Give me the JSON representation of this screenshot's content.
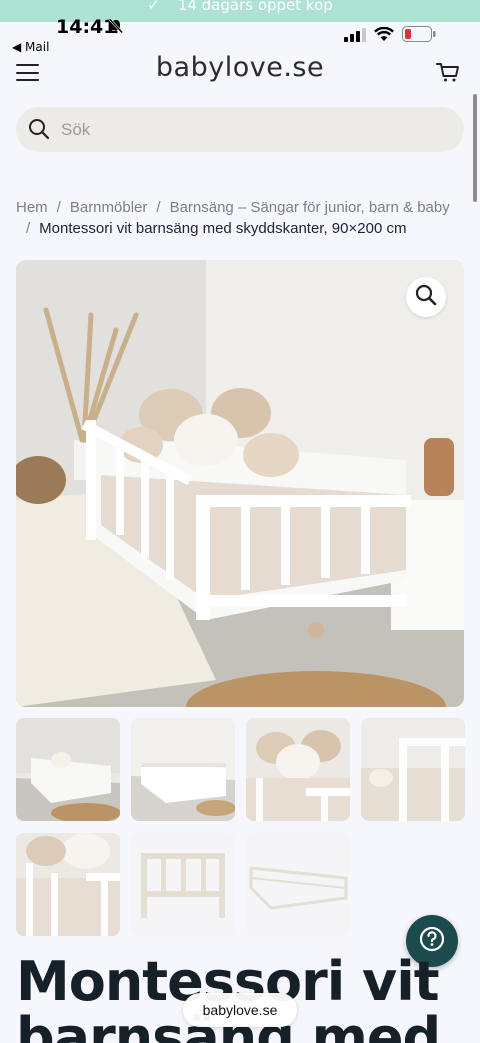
{
  "promo": {
    "text": "14 dagars öppet köp",
    "check": "✓"
  },
  "status_bar": {
    "time": "14:41",
    "back_label": "◀ Mail"
  },
  "header": {
    "logo": "babylove.se"
  },
  "search": {
    "placeholder": "Sök",
    "value": ""
  },
  "breadcrumb": {
    "items": [
      "Hem",
      "Barnmöbler",
      "Barnsäng – Sängar för junior, barn & baby"
    ],
    "current": "Montessori vit barnsäng med skyddskanter, 90×200 cm",
    "separator": "/"
  },
  "gallery": {
    "thumbnail_count": 7,
    "selected_index": 0
  },
  "product": {
    "title": "Montessori vit barnsäng med"
  },
  "browser": {
    "url": "babylove.se"
  },
  "colors": {
    "brand_teal": "#1c4b4e",
    "promo_bg": "#aee3d4",
    "bg": "#f6f7fc"
  },
  "icons": [
    "hamburger-icon",
    "cart-icon",
    "search-icon",
    "zoom-icon",
    "help-icon",
    "bell-slash-icon",
    "signal-icon",
    "wifi-icon",
    "battery-icon"
  ]
}
